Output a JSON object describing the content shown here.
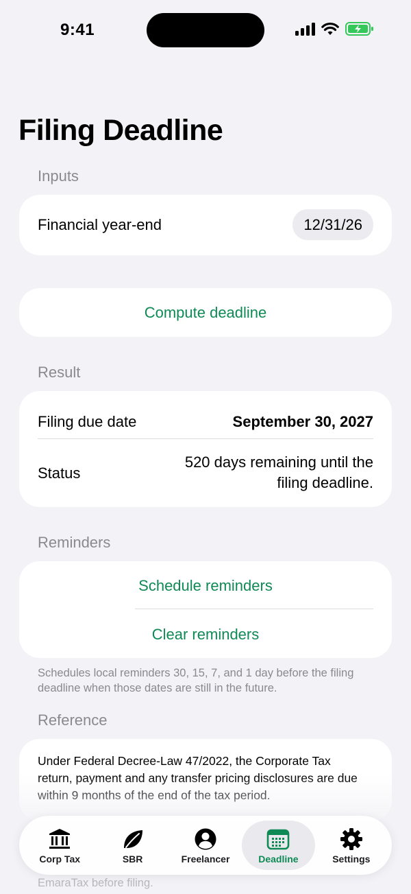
{
  "status_bar": {
    "time": "9:41"
  },
  "page": {
    "title": "Filing Deadline"
  },
  "inputs": {
    "header": "Inputs",
    "financial_year_end_label": "Financial year-end",
    "financial_year_end_value": "12/31/26"
  },
  "compute": {
    "label": "Compute deadline"
  },
  "result": {
    "header": "Result",
    "due_label": "Filing due date",
    "due_value": "September 30, 2027",
    "status_label": "Status",
    "status_value": "520 days remaining until the filing deadline."
  },
  "reminders": {
    "header": "Reminders",
    "schedule_label": "Schedule reminders",
    "clear_label": "Clear reminders",
    "footnote": "Schedules local reminders 30, 15, 7, and 1 day before the filing deadline when those dates are still in the future."
  },
  "reference": {
    "header": "Reference",
    "text": "Under Federal Decree-Law 47/2022, the Corporate Tax return, payment and any transfer pricing disclosures are due within 9 months of the end of the tax period.",
    "below_text": "EmaraTax before filing."
  },
  "tabs": [
    {
      "label": "Corp Tax",
      "icon": "bank-icon",
      "active": false
    },
    {
      "label": "SBR",
      "icon": "leaf-icon",
      "active": false
    },
    {
      "label": "Freelancer",
      "icon": "person-circle-icon",
      "active": false
    },
    {
      "label": "Deadline",
      "icon": "calendar-icon",
      "active": true
    },
    {
      "label": "Settings",
      "icon": "gear-icon",
      "active": false
    }
  ],
  "colors": {
    "accent": "#0f8a55",
    "background": "#f2f2f7",
    "card": "#ffffff",
    "secondary_text": "#8a8a8e",
    "battery": "#34c759"
  }
}
